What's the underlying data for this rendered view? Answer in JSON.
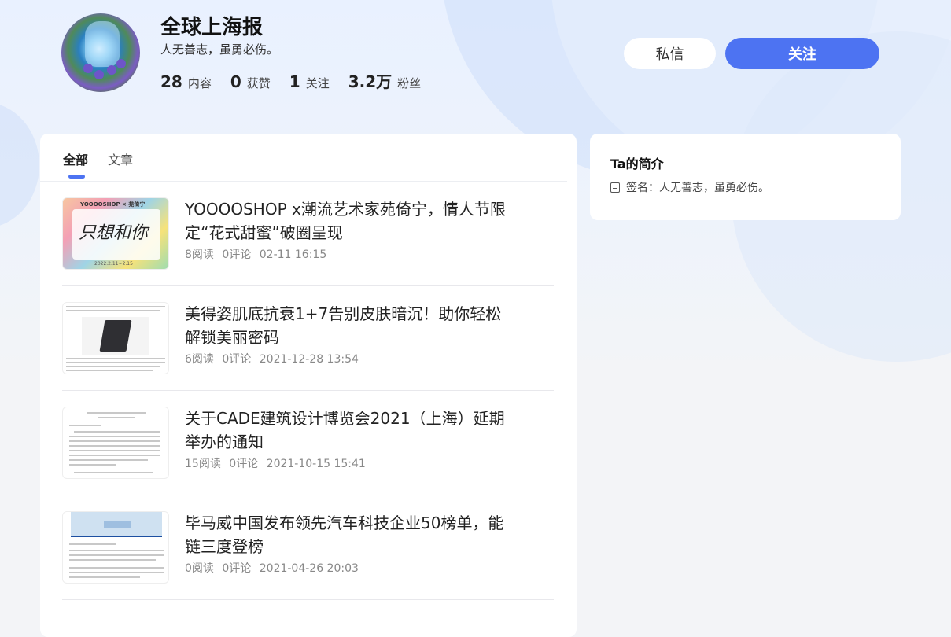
{
  "profile": {
    "name": "全球上海报",
    "bio": "人无善志，虽勇必伤。",
    "stats": [
      {
        "value": "28",
        "label": "内容"
      },
      {
        "value": "0",
        "label": "获赞"
      },
      {
        "value": "1",
        "label": "关注"
      },
      {
        "value": "3.2万",
        "label": "粉丝"
      }
    ]
  },
  "actions": {
    "message_label": "私信",
    "follow_label": "关注",
    "follow_color": "#4d73f2"
  },
  "tabs": [
    {
      "label": "全部",
      "active": true
    },
    {
      "label": "文章",
      "active": false
    }
  ],
  "articles": [
    {
      "title": "YOOOOSHOP x潮流艺术家苑倚宁，情人节限定“花式甜蜜”破圈呈现",
      "reads": "8阅读",
      "comments": "0评论",
      "date": "02-11 16:15",
      "thumb_text": {
        "logo": "YOOOOSHOP  ×  苑倚宁",
        "hand": "只想和你",
        "date": "2022.2.11~2.15"
      }
    },
    {
      "title": "美得姿肌底抗衰1+7告别皮肤暗沉！助你轻松解锁美丽密码",
      "reads": "6阅读",
      "comments": "0评论",
      "date": "2021-12-28 13:54"
    },
    {
      "title": "关于CADE建筑设计博览会2021（上海）延期举办的通知",
      "reads": "15阅读",
      "comments": "0评论",
      "date": "2021-10-15 15:41"
    },
    {
      "title": "毕马威中国发布领先汽车科技企业50榜单，能链三度登榜",
      "reads": "0阅读",
      "comments": "0评论",
      "date": "2021-04-26 20:03"
    }
  ],
  "sidebar": {
    "title": "Ta的简介",
    "signature": "签名：人无善志，虽勇必伤。"
  }
}
